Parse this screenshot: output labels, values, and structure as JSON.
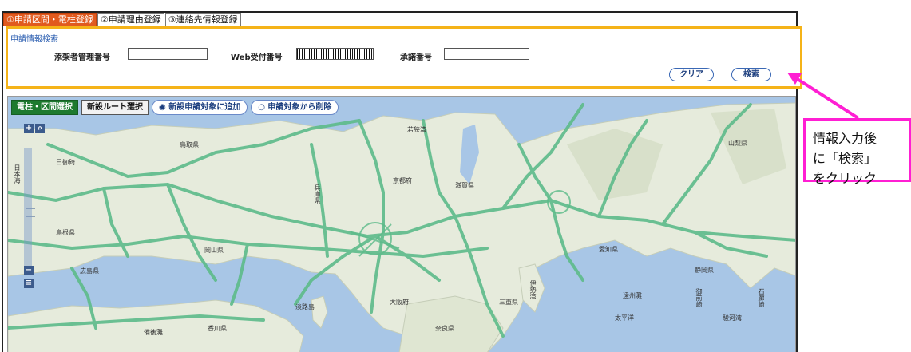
{
  "tabs": [
    {
      "label": "①申請区間・電柱登録",
      "active": true
    },
    {
      "label": "②申請理由登録",
      "active": false
    },
    {
      "label": "③連絡先情報登録",
      "active": false
    }
  ],
  "search": {
    "title": "申請情報検索",
    "fields": [
      {
        "label": "添架者管理番号",
        "value": ""
      },
      {
        "label": "Web受付番号",
        "value": "barcode"
      },
      {
        "label": "承諾番号",
        "value": ""
      }
    ],
    "clear_label": "クリア",
    "search_label": "検索"
  },
  "map": {
    "mode_buttons": [
      "電柱・区間選択",
      "新設ルート選択"
    ],
    "radio_buttons": [
      "◉ 新設申請対象に追加",
      "○ 申請対象から削除"
    ],
    "zoom_in": "+",
    "zoom_out": "−",
    "places": [
      "日御碕",
      "鳥取県",
      "島根県",
      "岡山県",
      "広島県",
      "兵庫県",
      "京都府",
      "滋賀県",
      "若狭湾",
      "愛知県",
      "静岡県",
      "山梨県",
      "大阪府",
      "奈良県",
      "三重県",
      "淡路島",
      "香川県",
      "伊勢湾",
      "遠州灘",
      "駿河湾",
      "日本海",
      "御前崎",
      "石廊崎",
      "太平洋",
      "備後灘"
    ]
  },
  "callout": {
    "lines": [
      "情報入力後",
      "に「検索」",
      "をクリック"
    ],
    "color": "#ff1fd3"
  },
  "colors": {
    "active_tab": "#e15a1e",
    "panel_border": "#f5b318",
    "road": "#5dbb8a",
    "sea": "#a8c6e6",
    "land": "#e6ebdc"
  }
}
